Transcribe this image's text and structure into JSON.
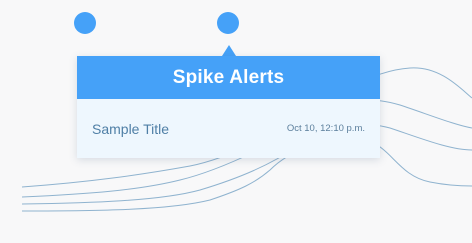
{
  "popup": {
    "title": "Spike Alerts",
    "alerts": [
      {
        "title": "Sample Title",
        "time": "Oct 10, 12:10 p.m."
      }
    ]
  },
  "colors": {
    "accent": "#45a1f8",
    "background": "#f8f8f9",
    "alert_row_bg": "#eef7fe",
    "line": "#8fb3cf"
  }
}
